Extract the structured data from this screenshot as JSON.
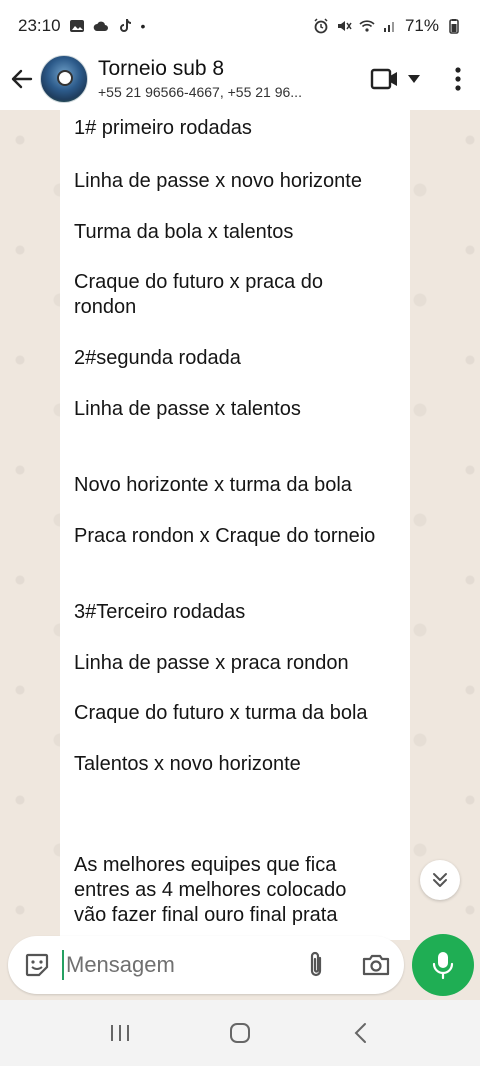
{
  "status": {
    "time": "23:10",
    "battery": "71%",
    "left_icons": [
      "image-icon",
      "cloud-icon",
      "tiktok-icon",
      "dot-icon"
    ],
    "right_icons": [
      "alarm-icon",
      "mute-icon",
      "wifi-icon",
      "signal-icon",
      "battery-icon"
    ]
  },
  "header": {
    "title": "Torneio sub 8",
    "subtitle": "+55 21 96566-4667, +55 21 96..."
  },
  "message": {
    "lines": [
      "1# primeiro rodadas",
      "Linha de passe x novo horizonte",
      "Turma da bola x talentos",
      "Craque do futuro x praca do",
      "rondon",
      "2#segunda rodada",
      "Linha de passe x talentos",
      "Novo horizonte x turma da bola",
      "Praca rondon x Craque do torneio",
      "3#Terceiro rodadas",
      "Linha de passe x praca rondon",
      "Craque do futuro x turma da bola",
      "Talentos x novo horizonte",
      "As melhores equipes que fica",
      "entres as 4 melhores colocado",
      "vão fazer  final  ouro final prata"
    ]
  },
  "input": {
    "placeholder": "Mensagem"
  },
  "colors": {
    "accent": "#1fae54",
    "chat_bg": "#efe7de",
    "bubble": "#ffffff"
  }
}
